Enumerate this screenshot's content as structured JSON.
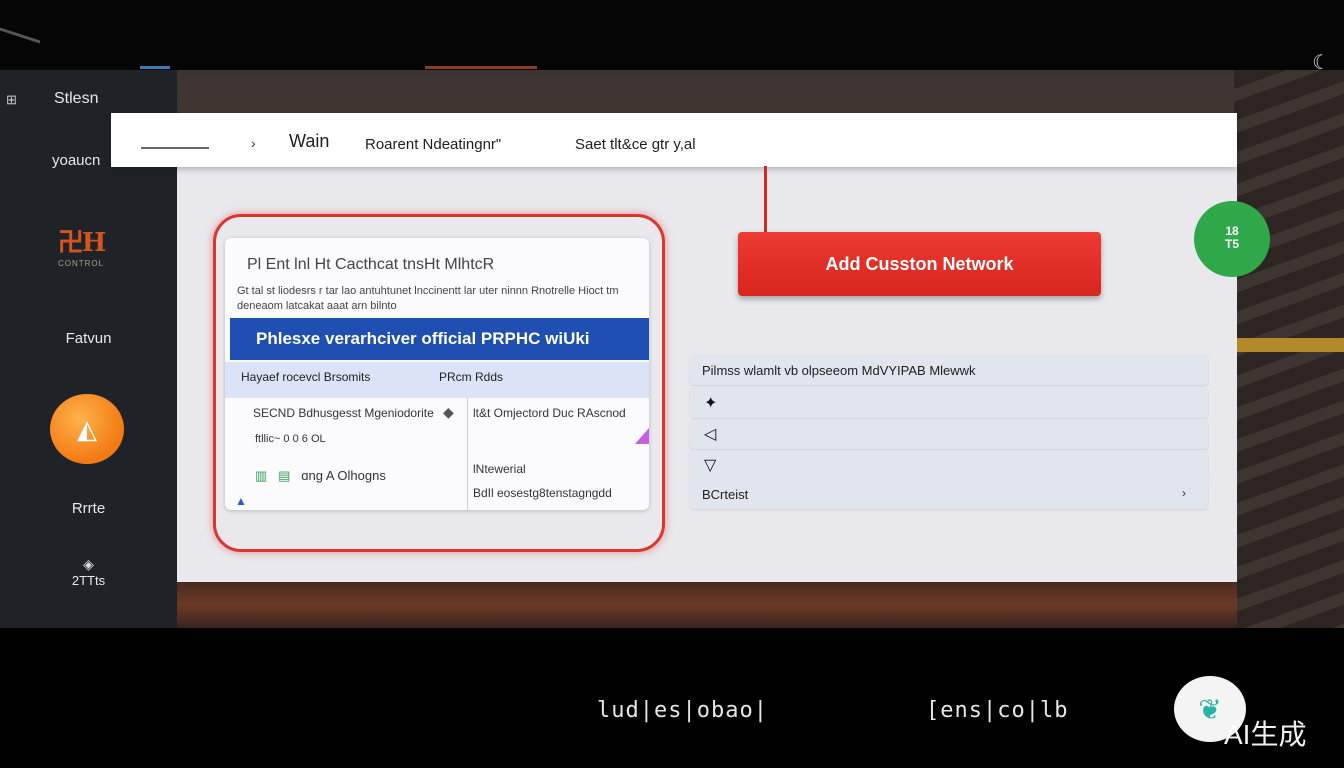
{
  "sidebar": {
    "top_glyph": "⊞",
    "items": [
      {
        "label": "Stlesn"
      },
      {
        "label": "yoaucn"
      },
      {
        "label": "Fatvun"
      },
      {
        "label": "Rrrte"
      },
      {
        "label": "2TTts"
      }
    ],
    "logo": {
      "glyph": "卍H",
      "sub": "CONTROL"
    },
    "orb_icon": "pizza-icon"
  },
  "navbar": {
    "tabs": [
      {
        "label": "Wain"
      },
      {
        "label": "Roarent Ndeatingnr\""
      },
      {
        "label": "Saet tlt&ce gtr y,al"
      }
    ]
  },
  "card": {
    "title": "Pl Ent lnl Ht Cacthcat tnsHt MlhtcR",
    "subtitle": "Gt tal st liodesrs r tar lao antuhtunet lnccinentt lar uter ninnn Rnotrelle Hioct tm deneaom latcakat aaat arn bilnto",
    "banner": "Phlesxe  verarhciver official PRPHC wiUki",
    "col1_header": "Hayaef rocevcl Brsomits",
    "col2_header": "PRcm Rdds",
    "row1_left": "SECND Bdhusgesst Mgeniodorite",
    "row1_right": "lt&t Omjectord Duc RAscnod",
    "row2": "ftllic~ 0  0  6 OL",
    "row3_left": "ɑng    A Olhogns",
    "row3_right_1": "lNtewerial",
    "row3_right_2": "BdIl eosestg8tenstagngdd"
  },
  "main": {
    "add_button": "Add Cusston Network",
    "badge_line1": "18",
    "badge_line2": "T5"
  },
  "list": {
    "rows": [
      {
        "text": "Pilmss wlamlt vb olpseeom MdVYIPAB Mlewwk"
      },
      {
        "text": ""
      },
      {
        "text": ""
      },
      {
        "text": ""
      },
      {
        "text": "BCrteist"
      }
    ]
  },
  "bottom": {
    "text1": "lud|es|obao|",
    "text2": "[ens|co|lb",
    "watermark": "AI生成"
  },
  "colors": {
    "accent_red": "#d8251e",
    "banner_blue": "#1f4fb2",
    "badge_green": "#2fa84a",
    "orb_orange": "#f27a12",
    "sidebar_bg": "#1f2327"
  }
}
